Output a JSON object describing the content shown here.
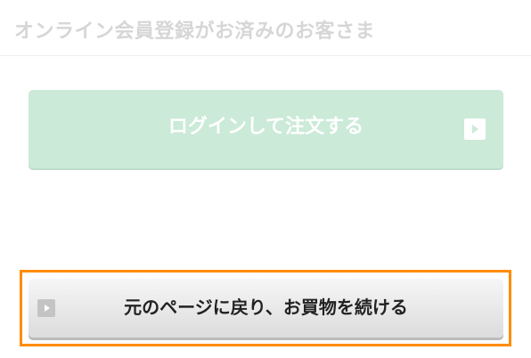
{
  "header": {
    "title": "オンライン会員登録がお済みのお客さま"
  },
  "login": {
    "label": "ログインして注文する",
    "icon": "play-arrow-icon",
    "color": "#cbead8"
  },
  "continue_shopping": {
    "label": "元のページに戻り、お買物を続ける",
    "icon": "play-arrow-icon",
    "highlight_color": "#ff8c00"
  }
}
